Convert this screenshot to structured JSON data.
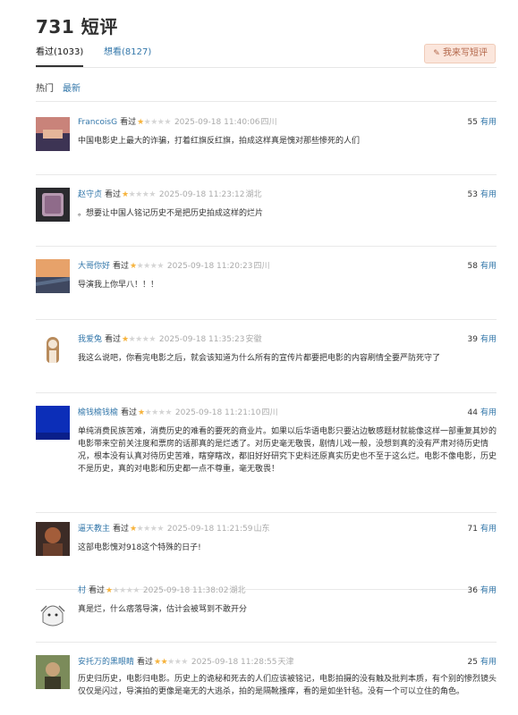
{
  "page": {
    "title": "731 短评"
  },
  "tabs": {
    "seen": "看过(1033)",
    "want": "想看(8127)"
  },
  "write_button": "我来写短评",
  "sort": {
    "hot": "热门",
    "new": "最新"
  },
  "vote_label": "有用",
  "comments": [
    {
      "user": "FrancoisG",
      "status": "看过",
      "rating": 1,
      "time": "2025-09-18 11:40:06",
      "location": "四川",
      "votes": "55",
      "text": "中国电影史上最大的诈骗，打着红旗反红旗，拍成这样真是愧对那些惨死的人们",
      "avatar_colors": [
        "#c9837a",
        "#3d3454"
      ]
    },
    {
      "user": "赵守贞",
      "status": "看过",
      "rating": 1,
      "time": "2025-09-18 11:23:12",
      "location": "湖北",
      "votes": "53",
      "text": "。想要让中国人铭记历史不是把历史拍成这样的烂片",
      "avatar_colors": [
        "#b699b0",
        "#2a2a2e"
      ]
    },
    {
      "user": "大哥你好",
      "status": "看过",
      "rating": 1,
      "time": "2025-09-18 11:20:23",
      "location": "四川",
      "votes": "58",
      "text": "导演我上你早八！！！",
      "avatar_colors": [
        "#e7a26a",
        "#3f4860"
      ]
    },
    {
      "user": "我爱兔",
      "status": "看过",
      "rating": 1,
      "time": "2025-09-18 11:35:23",
      "location": "安徽",
      "votes": "39",
      "text": "我这么说吧，你看完电影之后，就会该知道为什么所有的宣传片都要把电影的内容刷情全要严防死守了",
      "avatar_colors": [
        "#f3e6d6",
        "#b88b5c"
      ]
    },
    {
      "user": "榆钱榆钱榆",
      "status": "看过",
      "rating": 1,
      "time": "2025-09-18 11:21:10",
      "location": "四川",
      "votes": "44",
      "text": "单纯消费民族苦难，消费历史的难看的要死的商业片。如果以后华语电影只要沾边敏感题材就能像这样一部重复其妙的电影带来空前关注度和票房的话那真的是烂透了。对历史毫无敬畏，剧情儿戏一般，没想到真的没有严肃对待历史情况，根本没有认真对待历史苦难，瞎穿瞎改，都旧好好研究下史料还原真实历史也不至于这么烂。电影不像电影，历史不是历史，真的对电影和历史都一点不尊重，毫无敬畏！",
      "avatar_colors": [
        "#0c2eb8",
        "#0a1f8a"
      ]
    },
    {
      "user": "逼天教主",
      "status": "看过",
      "rating": 1,
      "time": "2025-09-18 11:21:59",
      "location": "山东",
      "votes": "71",
      "text": "这部电影愧对918这个特殊的日子!",
      "avatar_colors": [
        "#a35d3a",
        "#3c2b26"
      ]
    },
    {
      "user": "村",
      "status": "看过",
      "rating": 1,
      "time": "2025-09-18 11:38:02",
      "location": "湖北",
      "votes": "36",
      "text": "真是烂，什么痞落导演，估计会被骂到不敢开分",
      "avatar_colors": [
        "#f1f1f1",
        "#6f6f6f"
      ]
    },
    {
      "user": "安托万的黑眼睛",
      "status": "看过",
      "rating": 2,
      "time": "2025-09-18 11:28:55",
      "location": "天津",
      "votes": "25",
      "text": "历史归历史，电影归电影。历史上的诡秘和死去的人们应该被铭记，电影拍摄的没有触及批判本质，有个别的惨烈镜头仅仅是闪过，导演拍的更像是毫无的大逃杀，拍的是隔靴搔痒，看的是如坐针毡。没有一个可以立住的角色。",
      "avatar_colors": [
        "#7b8b5a",
        "#3b3a28"
      ]
    }
  ]
}
